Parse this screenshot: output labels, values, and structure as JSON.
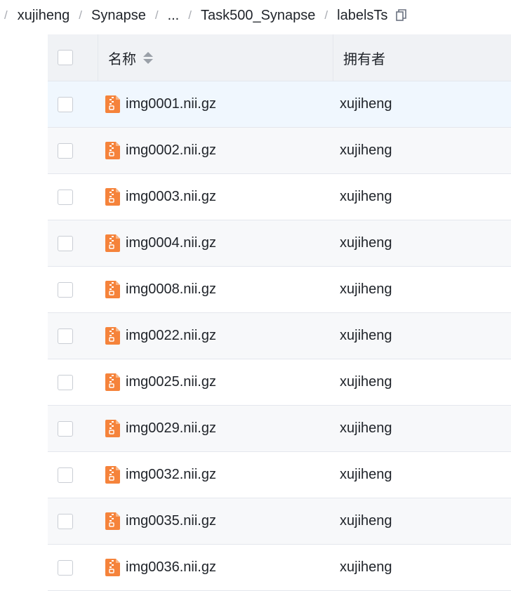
{
  "breadcrumb": {
    "items": [
      "xujiheng",
      "Synapse",
      "...",
      "Task500_Synapse",
      "labelsTs"
    ]
  },
  "table": {
    "columns": {
      "name": "名称",
      "owner": "拥有者"
    },
    "rows": [
      {
        "name": "img0001.nii.gz",
        "owner": "xujiheng"
      },
      {
        "name": "img0002.nii.gz",
        "owner": "xujiheng"
      },
      {
        "name": "img0003.nii.gz",
        "owner": "xujiheng"
      },
      {
        "name": "img0004.nii.gz",
        "owner": "xujiheng"
      },
      {
        "name": "img0008.nii.gz",
        "owner": "xujiheng"
      },
      {
        "name": "img0022.nii.gz",
        "owner": "xujiheng"
      },
      {
        "name": "img0025.nii.gz",
        "owner": "xujiheng"
      },
      {
        "name": "img0029.nii.gz",
        "owner": "xujiheng"
      },
      {
        "name": "img0032.nii.gz",
        "owner": "xujiheng"
      },
      {
        "name": "img0035.nii.gz",
        "owner": "xujiheng"
      },
      {
        "name": "img0036.nii.gz",
        "owner": "xujiheng"
      }
    ]
  },
  "icons": {
    "file": "zip-file-icon",
    "copy": "copy-icon",
    "sort": "sort-icon"
  },
  "colors": {
    "file_icon": "#f5833b",
    "hover_row": "#f0f7fe",
    "alt_row": "#f7f8fa",
    "header_bg": "#f0f2f5"
  }
}
